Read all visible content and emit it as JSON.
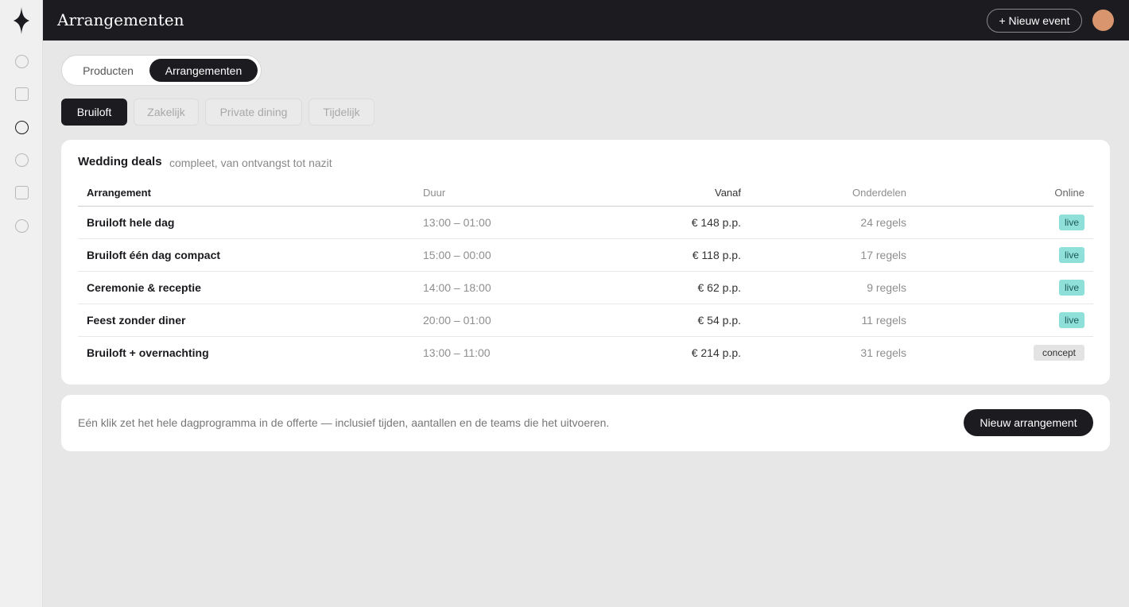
{
  "header": {
    "title": "Arrangementen",
    "new_event_label": "+ Nieuw event"
  },
  "sidebar": {
    "logo": "diamond-logo-icon",
    "items": [
      {
        "icon": "circle-icon",
        "active": false
      },
      {
        "icon": "square-icon",
        "active": false
      },
      {
        "icon": "circle-icon",
        "active": true
      },
      {
        "icon": "circle-icon",
        "active": false
      },
      {
        "icon": "square-icon",
        "active": false
      },
      {
        "icon": "circle-icon",
        "active": false
      }
    ]
  },
  "segmented": {
    "items": [
      "Producten",
      "Arrangementen"
    ],
    "selected": "Arrangementen"
  },
  "filters": {
    "items": [
      "Bruiloft",
      "Zakelijk",
      "Private dining",
      "Tijdelijk"
    ],
    "selected": "Bruiloft"
  },
  "deals": {
    "title": "Wedding deals",
    "subtitle": "compleet, van ontvangst tot nazit",
    "columns": [
      "Arrangement",
      "Duur",
      "Vanaf",
      "Onderdelen",
      "Online"
    ],
    "rows": [
      {
        "name": "Bruiloft hele dag",
        "duration": "13:00 – 01:00",
        "price": "€ 148 p.p.",
        "parts": "24 regels",
        "status": "live"
      },
      {
        "name": "Bruiloft één dag compact",
        "duration": "15:00 – 00:00",
        "price": "€ 118 p.p.",
        "parts": "17 regels",
        "status": "live"
      },
      {
        "name": "Ceremonie & receptie",
        "duration": "14:00 – 18:00",
        "price": "€ 62 p.p.",
        "parts": "9 regels",
        "status": "live"
      },
      {
        "name": "Feest zonder diner",
        "duration": "20:00 – 01:00",
        "price": "€ 54 p.p.",
        "parts": "11 regels",
        "status": "live"
      },
      {
        "name": "Bruiloft + overnachting",
        "duration": "13:00 – 11:00",
        "price": "€ 214 p.p.",
        "parts": "31 regels",
        "status": "concept"
      }
    ]
  },
  "footer": {
    "text": "Eén klik zet het hele dagprogramma in de offerte — inclusief tijden, aantallen en de teams die het uitvoeren.",
    "button_label": "Nieuw arrangement"
  },
  "colors": {
    "topbar": "#1b1b20",
    "live_badge": "#8ee0d8",
    "concept_badge": "#e3e3e3",
    "avatar": "#d9956e"
  }
}
